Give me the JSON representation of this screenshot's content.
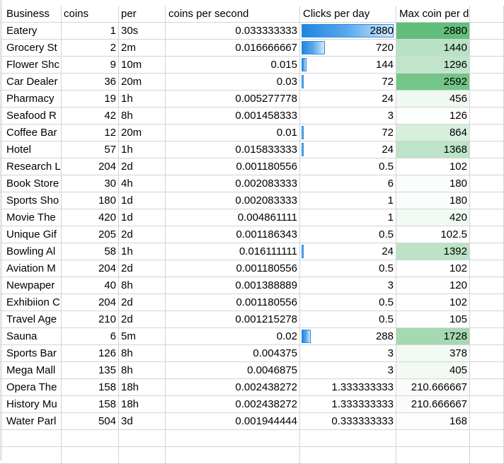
{
  "headers": [
    "Business",
    "coins",
    "per",
    "coins per second",
    "Clicks per day",
    "Max coin per day"
  ],
  "colors": {
    "databar_fill": "#1f86e0",
    "databar_border": "#2e8de0",
    "scale_max": "#63be7b",
    "scale_min": "#ffffff",
    "gridline": "#d4d4d4"
  },
  "rows": [
    {
      "business": "Eatery",
      "coins": "1",
      "per": "30s",
      "cps": "0.033333333",
      "clicks": "2880",
      "bar": 1.0,
      "max": "2880",
      "heat": 1.0
    },
    {
      "business": "Grocery St",
      "coins": "2",
      "per": "2m",
      "cps": "0.016666667",
      "clicks": "720",
      "bar": 0.25,
      "max": "1440",
      "heat": 0.45
    },
    {
      "business": "Flower Shc",
      "coins": "9",
      "per": "10m",
      "cps": "0.015",
      "clicks": "144",
      "bar": 0.05,
      "max": "1296",
      "heat": 0.4
    },
    {
      "business": "Car Dealer",
      "coins": "36",
      "per": "20m",
      "cps": "0.03",
      "clicks": "72",
      "bar": 0.025,
      "max": "2592",
      "heat": 0.9
    },
    {
      "business": "Pharmacy",
      "coins": "19",
      "per": "1h",
      "cps": "0.005277778",
      "clicks": "24",
      "bar": 0,
      "max": "456",
      "heat": 0.1
    },
    {
      "business": "Seafood R",
      "coins": "42",
      "per": "8h",
      "cps": "0.001458333",
      "clicks": "3",
      "bar": 0,
      "max": "126",
      "heat": 0.01
    },
    {
      "business": "Coffee Bar",
      "coins": "12",
      "per": "20m",
      "cps": "0.01",
      "clicks": "72",
      "bar": 0.025,
      "max": "864",
      "heat": 0.25
    },
    {
      "business": "Hotel",
      "coins": "57",
      "per": "1h",
      "cps": "0.015833333",
      "clicks": "24",
      "bar": 0.008,
      "max": "1368",
      "heat": 0.42
    },
    {
      "business": "Research L",
      "coins": "204",
      "per": "2d",
      "cps": "0.001180556",
      "clicks": "0.5",
      "bar": 0,
      "max": "102",
      "heat": 0.0
    },
    {
      "business": "Book Store",
      "coins": "30",
      "per": "4h",
      "cps": "0.002083333",
      "clicks": "6",
      "bar": 0,
      "max": "180",
      "heat": 0.03
    },
    {
      "business": "Sports Sho",
      "coins": "180",
      "per": "1d",
      "cps": "0.002083333",
      "clicks": "1",
      "bar": 0,
      "max": "180",
      "heat": 0.03
    },
    {
      "business": "Movie The",
      "coins": "420",
      "per": "1d",
      "cps": "0.004861111",
      "clicks": "1",
      "bar": 0,
      "max": "420",
      "heat": 0.09
    },
    {
      "business": "Unique Gif",
      "coins": "205",
      "per": "2d",
      "cps": "0.001186343",
      "clicks": "0.5",
      "bar": 0,
      "max": "102.5",
      "heat": 0.0
    },
    {
      "business": "Bowling Al",
      "coins": "58",
      "per": "1h",
      "cps": "0.016111111",
      "clicks": "24",
      "bar": 0.008,
      "max": "1392",
      "heat": 0.43
    },
    {
      "business": "Aviation M",
      "coins": "204",
      "per": "2d",
      "cps": "0.001180556",
      "clicks": "0.5",
      "bar": 0,
      "max": "102",
      "heat": 0.0
    },
    {
      "business": "Newpaper",
      "coins": "40",
      "per": "8h",
      "cps": "0.001388889",
      "clicks": "3",
      "bar": 0,
      "max": "120",
      "heat": 0.01
    },
    {
      "business": "Exhibiion C",
      "coins": "204",
      "per": "2d",
      "cps": "0.001180556",
      "clicks": "0.5",
      "bar": 0,
      "max": "102",
      "heat": 0.0
    },
    {
      "business": "Travel Age",
      "coins": "210",
      "per": "2d",
      "cps": "0.001215278",
      "clicks": "0.5",
      "bar": 0,
      "max": "105",
      "heat": 0.0
    },
    {
      "business": "Sauna",
      "coins": "6",
      "per": "5m",
      "cps": "0.02",
      "clicks": "288",
      "bar": 0.1,
      "max": "1728",
      "heat": 0.58
    },
    {
      "business": "Sports Bar",
      "coins": "126",
      "per": "8h",
      "cps": "0.004375",
      "clicks": "3",
      "bar": 0,
      "max": "378",
      "heat": 0.08
    },
    {
      "business": "Mega Mall",
      "coins": "135",
      "per": "8h",
      "cps": "0.0046875",
      "clicks": "3",
      "bar": 0,
      "max": "405",
      "heat": 0.08
    },
    {
      "business": "Opera The",
      "coins": "158",
      "per": "18h",
      "cps": "0.002438272",
      "clicks": "1.333333333",
      "bar": 0,
      "max": "210.666667",
      "heat": 0.04
    },
    {
      "business": "History Mu",
      "coins": "158",
      "per": "18h",
      "cps": "0.002438272",
      "clicks": "1.333333333",
      "bar": 0,
      "max": "210.666667",
      "heat": 0.04
    },
    {
      "business": "Water Parl",
      "coins": "504",
      "per": "3d",
      "cps": "0.001944444",
      "clicks": "0.333333333",
      "bar": 0,
      "max": "168",
      "heat": 0.02
    }
  ]
}
